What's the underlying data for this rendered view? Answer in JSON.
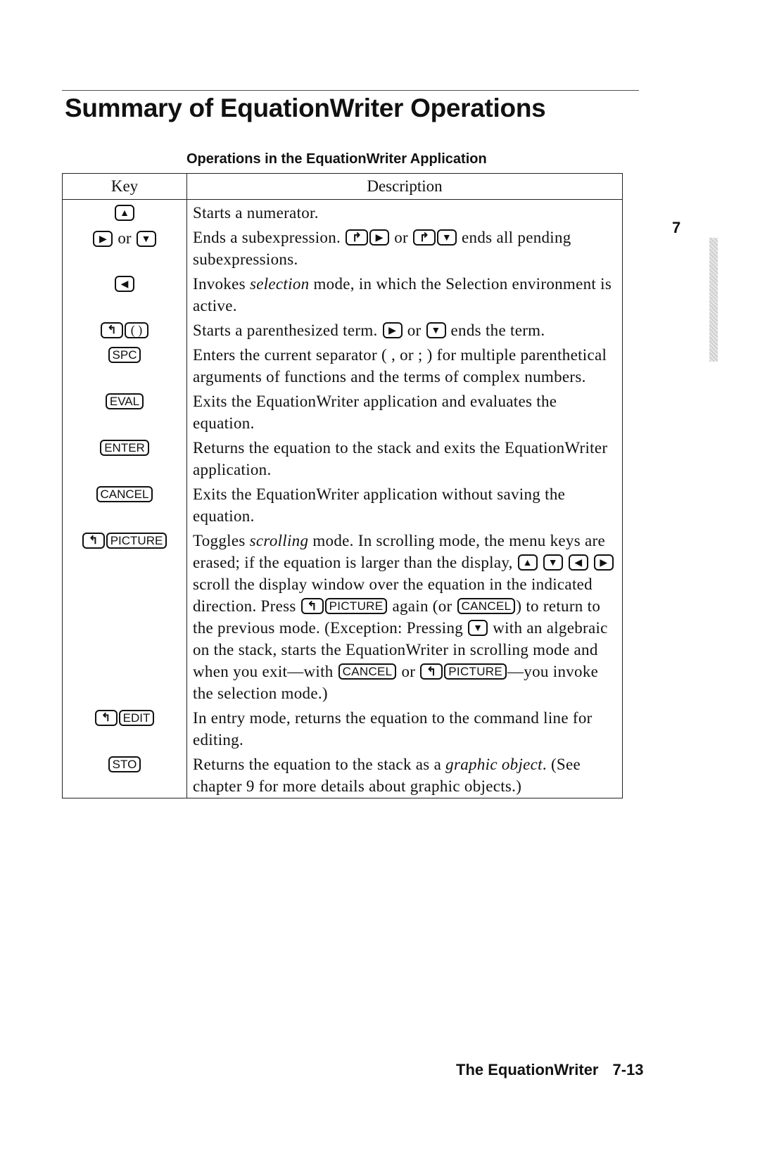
{
  "page": {
    "section_title": "Summary of EquationWriter Operations",
    "table_caption": "Operations in the EquationWriter Application",
    "chapter_tab": "7",
    "footer": {
      "chapter_title": "The EquationWriter",
      "page_number": "7-13"
    }
  },
  "table": {
    "headers": {
      "key": "Key",
      "description": "Description"
    },
    "or_word": "or",
    "rows": [
      {
        "keys": [
          [
            "up-arrow"
          ]
        ],
        "description": [
          {
            "t": "Starts a numerator."
          }
        ]
      },
      {
        "keys": [
          [
            "right-arrow"
          ],
          [
            "down-arrow"
          ]
        ],
        "description": [
          {
            "t": "Ends a subexpression. "
          },
          {
            "k": "right-shift"
          },
          {
            "k": "right-arrow"
          },
          {
            "t": " or "
          },
          {
            "k": "right-shift"
          },
          {
            "k": "down-arrow"
          },
          {
            "t": " ends all pending subexpressions."
          }
        ]
      },
      {
        "keys": [
          [
            "left-arrow"
          ]
        ],
        "description": [
          {
            "t": "Invokes "
          },
          {
            "i": "selection"
          },
          {
            "t": " mode, in which the Selection environment is active."
          }
        ]
      },
      {
        "keys": [
          [
            "left-shift",
            "paren"
          ]
        ],
        "description": [
          {
            "t": "Starts a parenthesized term. "
          },
          {
            "k": "right-arrow"
          },
          {
            "t": " or "
          },
          {
            "k": "down-arrow"
          },
          {
            "t": " ends the term."
          }
        ]
      },
      {
        "keys": [
          [
            "SPC"
          ]
        ],
        "description": [
          {
            "t": "Enters the current separator ( , or ; ) for multiple parenthetical arguments of functions and the terms of complex numbers."
          }
        ]
      },
      {
        "keys": [
          [
            "EVAL"
          ]
        ],
        "description": [
          {
            "t": "Exits the EquationWriter application and evaluates the equation."
          }
        ]
      },
      {
        "keys": [
          [
            "ENTER"
          ]
        ],
        "description": [
          {
            "t": "Returns the equation to the stack and exits the EquationWriter application."
          }
        ]
      },
      {
        "keys": [
          [
            "CANCEL"
          ]
        ],
        "description": [
          {
            "t": "Exits the EquationWriter application without saving the equation."
          }
        ]
      },
      {
        "keys": [
          [
            "left-shift",
            "PICTURE"
          ]
        ],
        "description": [
          {
            "t": "Toggles "
          },
          {
            "i": "scrolling"
          },
          {
            "t": " mode. In scrolling mode, the menu keys are erased; if the equation is larger than the display, "
          },
          {
            "k": "up-arrow"
          },
          {
            "t": " "
          },
          {
            "k": "down-arrow"
          },
          {
            "t": " "
          },
          {
            "k": "left-arrow"
          },
          {
            "t": " "
          },
          {
            "k": "right-arrow"
          },
          {
            "t": " scroll the display window over the equation in the indicated direction. Press "
          },
          {
            "k": "left-shift"
          },
          {
            "k": "PICTURE"
          },
          {
            "t": " again (or "
          },
          {
            "k": "CANCEL"
          },
          {
            "t": ") to return to the previous mode. (Exception: Pressing "
          },
          {
            "k": "down-arrow"
          },
          {
            "t": " with an algebraic on the stack, starts the EquationWriter in scrolling mode and when you exit—with "
          },
          {
            "k": "CANCEL"
          },
          {
            "t": " or "
          },
          {
            "k": "left-shift"
          },
          {
            "k": "PICTURE"
          },
          {
            "t": "—you invoke the selection mode.)"
          }
        ]
      },
      {
        "keys": [
          [
            "left-shift",
            "EDIT"
          ]
        ],
        "description": [
          {
            "t": "In entry mode, returns the equation to the command line for editing."
          }
        ]
      },
      {
        "keys": [
          [
            "STO"
          ]
        ],
        "description": [
          {
            "t": "Returns the equation to the stack as a "
          },
          {
            "i": "graphic object"
          },
          {
            "t": ". (See chapter 9 for more details about graphic objects.)"
          }
        ]
      }
    ]
  },
  "key_glyphs": {
    "up-arrow": "▲",
    "down-arrow": "▼",
    "left-arrow": "◀",
    "right-arrow": "▶",
    "left-shift": "↰",
    "right-shift": "↱",
    "paren": "( )"
  }
}
